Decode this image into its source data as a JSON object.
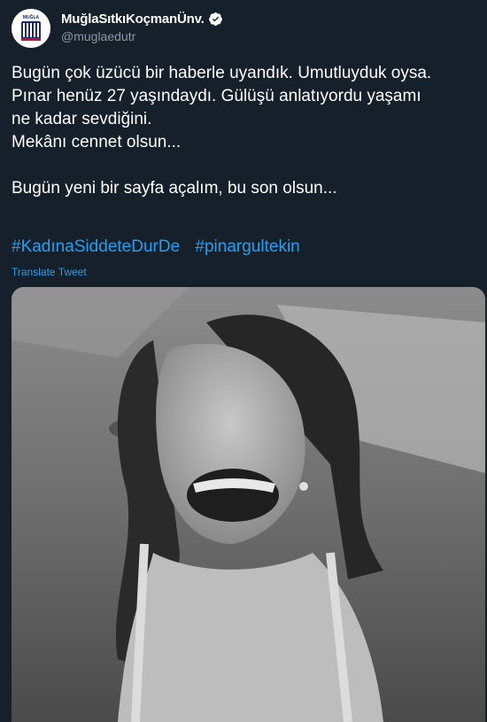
{
  "account": {
    "display_name": "MuğlaSıtkıKoçmanÜnv.",
    "handle": "@muglaedutr",
    "avatar_text": "MUĞLA",
    "verified": true
  },
  "tweet": {
    "lines_para1": [
      "Bugün çok üzücü bir haberle uyandık. Umutluyduk oysa.",
      "Pınar henüz 27 yaşındaydı. Gülüşü anlatıyordu yaşamı",
      "ne kadar sevdiğini.",
      "Mekânı cennet olsun..."
    ],
    "line_para2": "Bugün yeni bir sayfa açalım, bu son olsun...",
    "hashtags": [
      "#KadınaSiddeteDurDe",
      "#pinargultekin"
    ],
    "translate_label": "Translate Tweet"
  },
  "colors": {
    "background": "#15202b",
    "text": "#ffffff",
    "link": "#1da1f2",
    "secondary": "#8899a6"
  }
}
